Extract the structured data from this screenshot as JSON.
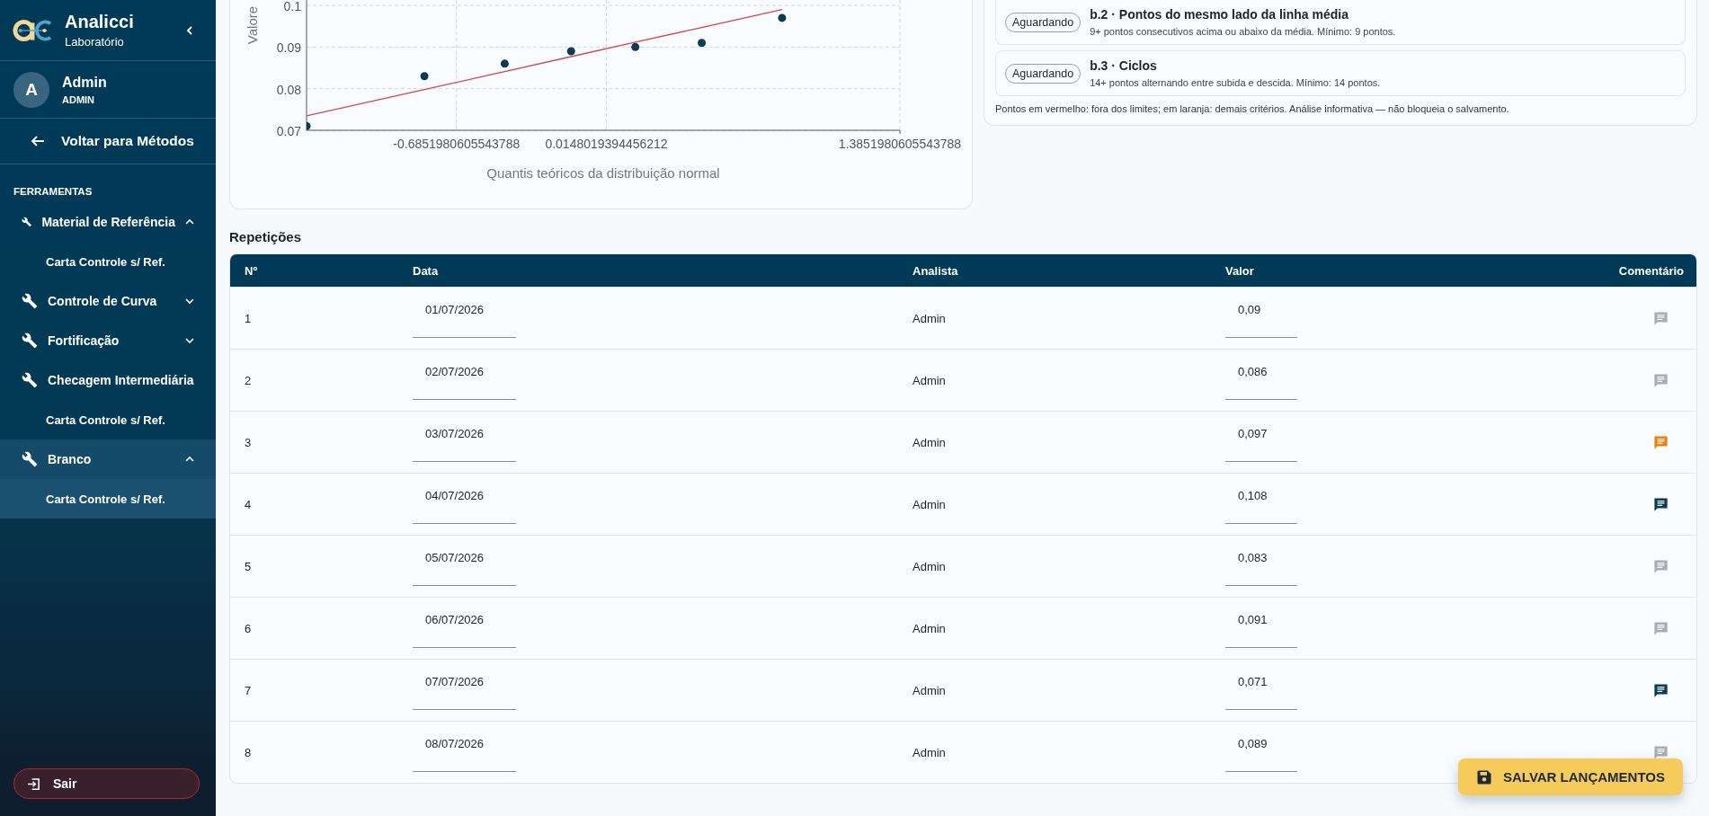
{
  "sidebar": {
    "brand": {
      "name": "Analicci",
      "subtitle": "Laboratório"
    },
    "user": {
      "initial": "A",
      "name": "Admin",
      "role": "ADMIN"
    },
    "back_link": "Voltar para Métodos",
    "section_title": "FERRAMENTAS",
    "groups": [
      {
        "label": "Material de Referência",
        "expanded": true,
        "selected": false,
        "children": [
          {
            "label": "Carta Controle s/ Ref.",
            "selected": false
          }
        ]
      },
      {
        "label": "Controle de Curva",
        "expanded": false,
        "selected": false
      },
      {
        "label": "Fortificação",
        "expanded": false,
        "selected": false
      },
      {
        "label": "Checagem Intermediária",
        "selected": false,
        "children": [
          {
            "label": "Carta Controle s/ Ref.",
            "selected": false
          }
        ]
      },
      {
        "label": "Branco",
        "expanded": true,
        "selected": true,
        "children": [
          {
            "label": "Carta Controle s/ Ref.",
            "selected": true
          }
        ]
      }
    ],
    "logout": "Sair"
  },
  "qq_chart": {
    "chart_data": {
      "type": "scatter",
      "ylabel": "Valore",
      "xlabel": "Quantis teóricos da distribuição normal",
      "x": [
        -1.385,
        -0.835,
        -0.46,
        -0.15,
        0.15,
        0.46,
        0.835
      ],
      "series": [
        {
          "color": "#0b3a55",
          "values": [
            0.071,
            0.083,
            0.086,
            0.089,
            0.09,
            0.091,
            0.097
          ]
        },
        {
          "type": "line",
          "color": "#d64545",
          "values": [
            0.0735,
            0.0798,
            0.0841,
            0.0877,
            0.0912,
            0.0947,
            0.099
          ]
        }
      ],
      "grid": true,
      "xlim": [
        -1.3851980605543788,
        1.3851980605543788
      ],
      "ylim": [
        0.07,
        0.1
      ],
      "xticks": [
        {
          "value": -0.6851980605543788,
          "label": "-0.6851980605543788"
        },
        {
          "value": 0.0148019394456212,
          "label": "0.0148019394456212"
        },
        {
          "value": 1.3851980605543788,
          "label": "1.3851980605543788"
        }
      ],
      "yticks": [
        {
          "value": 0.07,
          "label": "0.07"
        },
        {
          "value": 0.08,
          "label": "0.08"
        },
        {
          "value": 0.09,
          "label": "0.09"
        },
        {
          "value": 0.1,
          "label": "0.1"
        }
      ]
    }
  },
  "rules_panel": {
    "rules": [
      {
        "status": "Aguardando",
        "title": "b.2 · Pontos do mesmo lado da linha média",
        "description": "9+ pontos consecutivos acima ou abaixo da média. Mínimo: 9 pontos."
      },
      {
        "status": "Aguardando",
        "title": "b.3 · Ciclos",
        "description": "14+ pontos alternando entre subida e descida. Mínimo: 14 pontos."
      }
    ],
    "note": "Pontos em vermelho: fora dos limites; em laranja: demais critérios. Análise informativa — não bloqueia o salvamento."
  },
  "repetitions": {
    "title": "Repetições",
    "columns": [
      "Nº",
      "Data",
      "Analista",
      "Valor",
      "Comentário"
    ],
    "rows": [
      {
        "n": "1",
        "date": "01/07/2026",
        "analyst": "Admin",
        "value": "0,09",
        "comment": {
          "kind": "empty"
        }
      },
      {
        "n": "2",
        "date": "02/07/2026",
        "analyst": "Admin",
        "value": "0,086",
        "comment": {
          "kind": "empty"
        }
      },
      {
        "n": "3",
        "date": "03/07/2026",
        "analyst": "Admin",
        "value": "0,097",
        "comment": {
          "kind": "flagged"
        }
      },
      {
        "n": "4",
        "date": "04/07/2026",
        "analyst": "Admin",
        "value": "0,108",
        "comment": {
          "kind": "written"
        }
      },
      {
        "n": "5",
        "date": "05/07/2026",
        "analyst": "Admin",
        "value": "0,083",
        "comment": {
          "kind": "empty"
        }
      },
      {
        "n": "6",
        "date": "06/07/2026",
        "analyst": "Admin",
        "value": "0,091",
        "comment": {
          "kind": "empty"
        }
      },
      {
        "n": "7",
        "date": "07/07/2026",
        "analyst": "Admin",
        "value": "0,071",
        "comment": {
          "kind": "written"
        }
      },
      {
        "n": "8",
        "date": "08/07/2026",
        "analyst": "Admin",
        "value": "0,089",
        "comment": {
          "kind": "empty"
        }
      }
    ]
  },
  "save_button": "SALVAR LANÇAMENTOS"
}
